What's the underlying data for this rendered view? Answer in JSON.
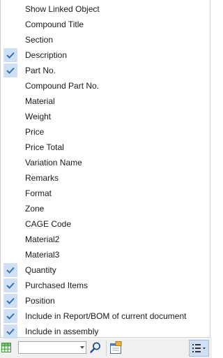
{
  "menu": {
    "items": [
      {
        "label": "Show Linked Object",
        "checked": false
      },
      {
        "label": "Compound Title",
        "checked": false
      },
      {
        "label": "Section",
        "checked": false
      },
      {
        "label": "Description",
        "checked": true
      },
      {
        "label": "Part No.",
        "checked": true
      },
      {
        "label": "Compound Part No.",
        "checked": false
      },
      {
        "label": "Material",
        "checked": false
      },
      {
        "label": "Weight",
        "checked": false
      },
      {
        "label": "Price",
        "checked": false
      },
      {
        "label": "Price Total",
        "checked": false
      },
      {
        "label": "Variation Name",
        "checked": false
      },
      {
        "label": "Remarks",
        "checked": false
      },
      {
        "label": "Format",
        "checked": false
      },
      {
        "label": "Zone",
        "checked": false
      },
      {
        "label": "CAGE Code",
        "checked": false
      },
      {
        "label": "Material2",
        "checked": false
      },
      {
        "label": "Material3",
        "checked": false
      },
      {
        "label": "Quantity",
        "checked": true
      },
      {
        "label": "Purchased Items",
        "checked": true
      },
      {
        "label": "Position",
        "checked": true
      },
      {
        "label": "Include in Report/BOM of current document",
        "checked": true
      },
      {
        "label": "Include in assembly",
        "checked": true
      }
    ]
  },
  "toolbar": {
    "search_value": "",
    "grid_icon": "green-grid-icon",
    "search_icon": "magnifier-icon",
    "properties_icon": "properties-icon",
    "list_icon": "list-options-icon"
  },
  "colors": {
    "check_bg": "#cfe0f5",
    "check_mark": "#3c6fb0",
    "toolbar_bg": "#f0f0f0",
    "grid_green": "#3f9a3a"
  }
}
